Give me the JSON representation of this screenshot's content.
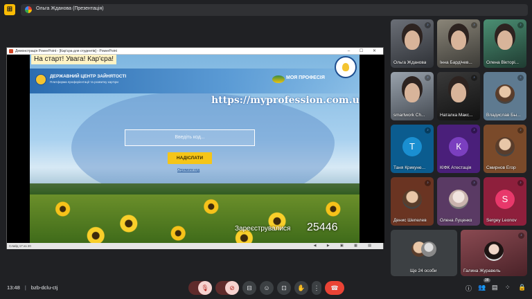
{
  "header": {
    "menu_icon": "⊞",
    "presenter_label": "Ольга Жданова (Презентація)"
  },
  "ppt": {
    "window_title": "Демонстрація PowerPoint - [Кар'єра для студентів] - PowerPoint",
    "window_controls": "– ☐ ✕",
    "slide_counter": "Слайд 17 из 20",
    "nav_glyphs": "◀ ▶ ▣ ▦ ▤"
  },
  "slide": {
    "tag": "На старт! Увага! Кар'єра!",
    "agency": "ДЕРЖАВНИЙ ЦЕНТР ЗАЙНЯТОСТІ",
    "agency_sub": "Платформа профорієнтації та розвитку кар'єри",
    "brand": "МОЯ ПРОФЕСІЯ",
    "url": "https://myprofession.com.ua/",
    "code_placeholder": "Введіть код...",
    "send_label": "НАДІСЛАТИ",
    "get_code": "Отримати код",
    "registered_label": "Зареєструвалися",
    "registered_count": "25446"
  },
  "participants": [
    {
      "name": "Ольга Жданова"
    },
    {
      "name": "Інна Бардічев..."
    },
    {
      "name": "Олена Вікторі..."
    },
    {
      "name": "smartwork Ch..."
    },
    {
      "name": "Наталка Макс..."
    },
    {
      "name": "Владислав Бы..."
    },
    {
      "name": "Таня Крикуне...",
      "initial": "Т"
    },
    {
      "name": "КІФК Атестація",
      "initial": "К"
    },
    {
      "name": "Смирнов Егор"
    },
    {
      "name": "Денис Шепелев"
    },
    {
      "name": "Олена Луценко"
    },
    {
      "name": "Sergey Leonov",
      "initial": "S"
    },
    {
      "name": "Ще 24 особи"
    },
    {
      "name": "Галина Журавель"
    }
  ],
  "bottom": {
    "time": "13:48",
    "separator": "|",
    "meeting_code": "bzb-dclu-ctj",
    "participant_badge": "38",
    "icons": {
      "mic": "🎙",
      "cam": "⊘",
      "cc": "⊟",
      "emoji": "☺",
      "present": "⊡",
      "hand": "✋",
      "more": "⋮",
      "hangup": "☎",
      "info": "ⓘ",
      "people": "👥",
      "chat": "▤",
      "activities": "⁘",
      "lock": "🔒"
    }
  },
  "colors": {
    "background": "#202124",
    "accent_red": "#ea4335",
    "accent_yellow": "#fbbc04",
    "accent_blue": "#8ab4f8"
  }
}
